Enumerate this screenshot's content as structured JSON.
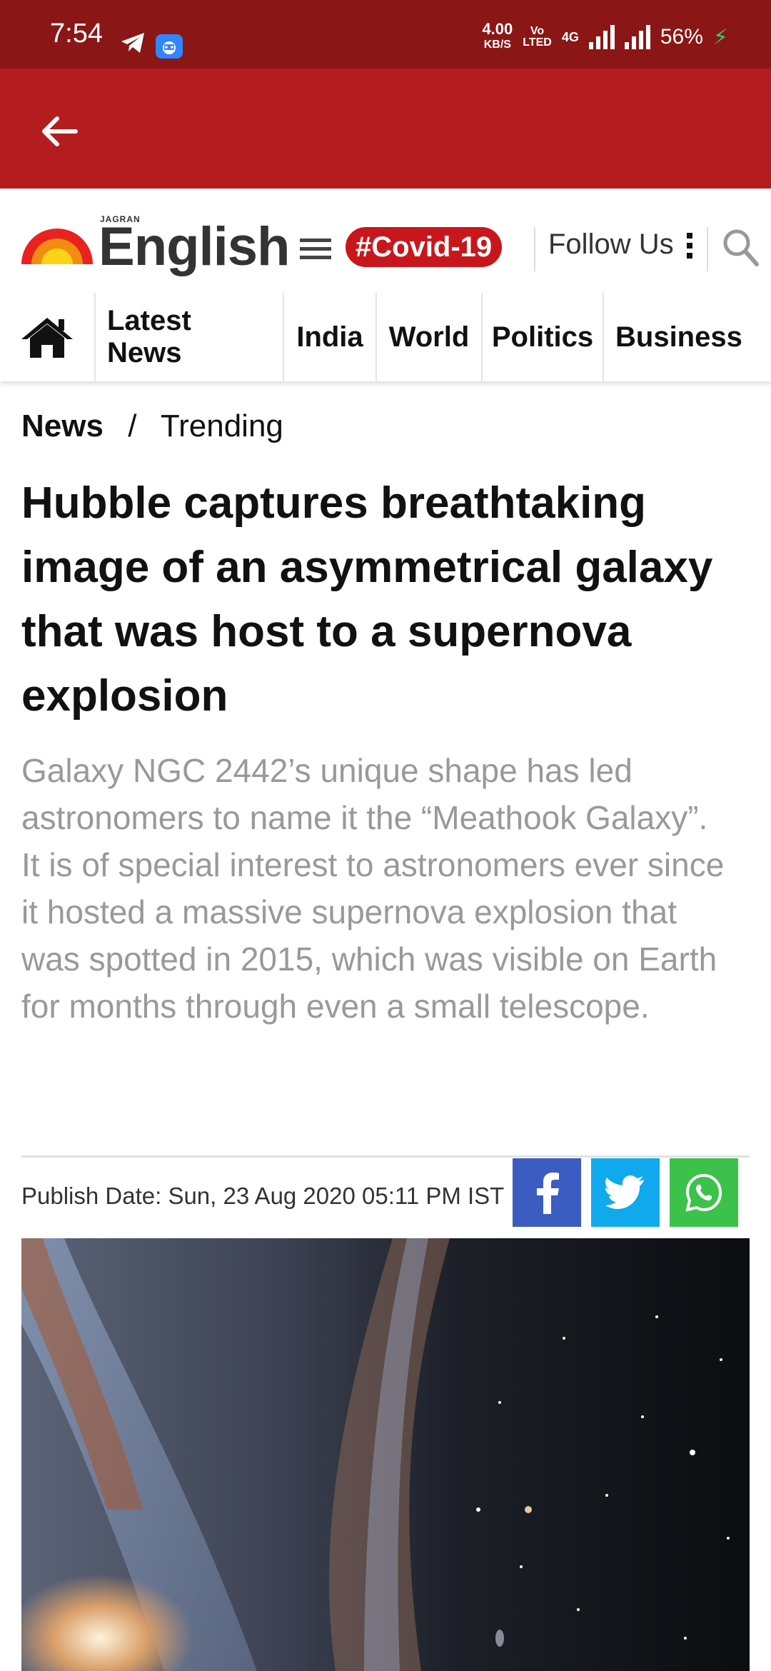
{
  "status_bar": {
    "time": "7:54",
    "net_speed_value": "4.00",
    "net_speed_unit": "KB/S",
    "volte_line1": "Vo",
    "volte_line2": "LTED",
    "network_type": "4G",
    "battery": "56%"
  },
  "site": {
    "logo_small": "JAGRAN",
    "logo_main": "English",
    "covid_tag": "#Covid-19",
    "follow_label": "Follow Us"
  },
  "nav": {
    "items": [
      "Latest News",
      "India",
      "World",
      "Politics",
      "Business"
    ]
  },
  "breadcrumb": {
    "root": "News",
    "separator": "/",
    "current": "Trending"
  },
  "article": {
    "headline": "Hubble captures breathtaking image of an asymmetrical galaxy that was host to a supernova explosion",
    "summary": "Galaxy NGC 2442’s unique shape has led astronomers to name it the “Meathook Galaxy”. It is of special interest to astronomers ever since it hosted a massive supernova explosion that was spotted in 2015, which was visible on Earth for months through even a small telescope.",
    "publish_date": "Publish Date: Sun, 23 Aug 2020 05:11 PM IST"
  },
  "colors": {
    "status_bar": "#8b1616",
    "app_bar": "#b51c1f",
    "covid_tag": "#c8171c",
    "facebook": "#3b5cc0",
    "twitter": "#11a9ee",
    "whatsapp": "#3cc24a"
  }
}
